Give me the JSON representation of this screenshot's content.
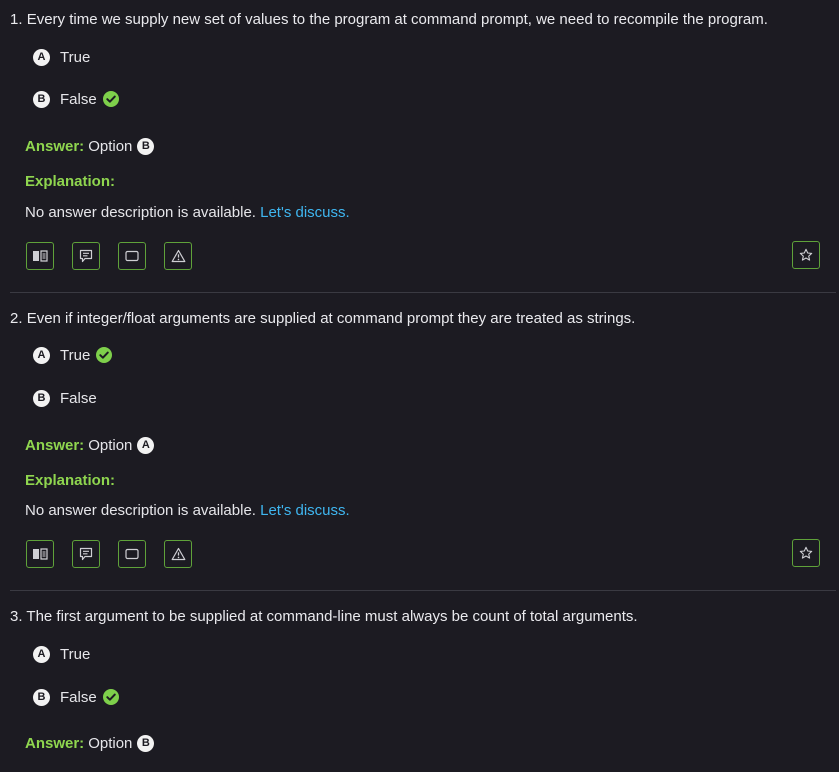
{
  "questions": [
    {
      "number": "1.",
      "text": "Every time we supply new set of values to the program at command prompt, we need to recompile the program.",
      "options": [
        {
          "key": "A",
          "label": "True",
          "correct": false
        },
        {
          "key": "B",
          "label": "False",
          "correct": true
        }
      ],
      "answer_key_label": "Answer:",
      "answer_text": "Option",
      "answer_option": "B",
      "explanation_heading": "Explanation:",
      "explanation_text": "No answer description is available.",
      "discuss_link": "Let's discuss."
    },
    {
      "number": "2.",
      "text": "Even if integer/float arguments are supplied at command prompt they are treated as strings.",
      "options": [
        {
          "key": "A",
          "label": "True",
          "correct": true
        },
        {
          "key": "B",
          "label": "False",
          "correct": false
        }
      ],
      "answer_key_label": "Answer:",
      "answer_text": "Option",
      "answer_option": "A",
      "explanation_heading": "Explanation:",
      "explanation_text": "No answer description is available.",
      "discuss_link": "Let's discuss."
    },
    {
      "number": "3.",
      "text": "The first argument to be supplied at command-line must always be count of total arguments.",
      "options": [
        {
          "key": "A",
          "label": "True",
          "correct": false
        },
        {
          "key": "B",
          "label": "False",
          "correct": true
        }
      ],
      "answer_key_label": "Answer:",
      "answer_text": "Option",
      "answer_option": "B"
    }
  ],
  "toolbar_icons": [
    "book-icon",
    "comment-icon",
    "workspace-icon",
    "report-icon",
    "bookmark-star-icon"
  ],
  "colors": {
    "background": "#1c1b22",
    "accent_green": "#8fd64f",
    "link_blue": "#3fb6f0",
    "border_green": "#5fa23a",
    "check_green": "#7ed04b"
  }
}
